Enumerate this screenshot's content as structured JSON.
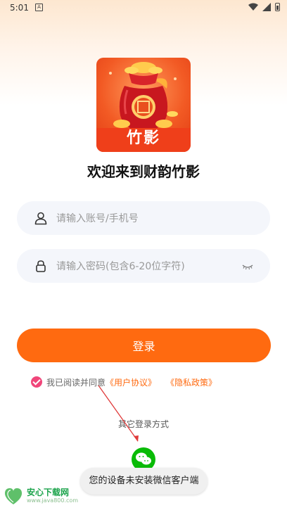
{
  "status_bar": {
    "time": "5:01",
    "notification_icon": "A"
  },
  "logo": {
    "text": "竹影"
  },
  "welcome": "欢迎来到财韵竹影",
  "account_field": {
    "placeholder": "请输入账号/手机号"
  },
  "password_field": {
    "placeholder": "请输入密码(包含6-20位字符)"
  },
  "login_button": "登录",
  "agreement": {
    "prefix": "我已阅读并同意",
    "user_agreement": "《用户协议》",
    "privacy_policy": "《隐私政策》",
    "checked": true
  },
  "other_login": "其它登录方式",
  "toast": "您的设备未安装微信客户端",
  "watermark": {
    "title": "安心下载网",
    "url": "www.java800.com"
  },
  "colors": {
    "accent": "#ff6a10",
    "check": "#f0467a",
    "wechat": "#09bb07",
    "field_bg": "#f4f6fb"
  }
}
